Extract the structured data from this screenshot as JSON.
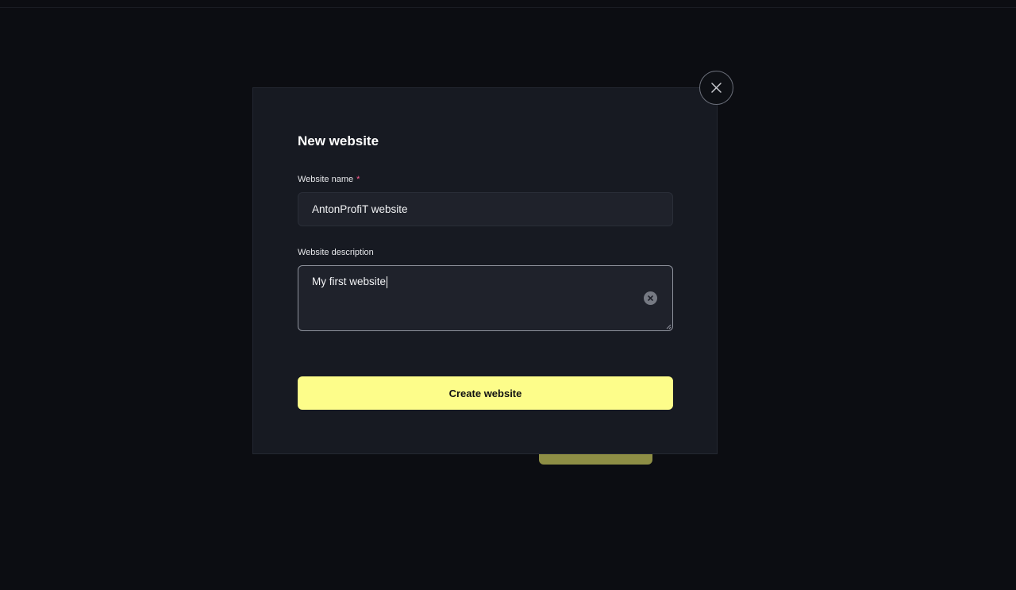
{
  "modal": {
    "title": "New website",
    "name_field": {
      "label": "Website name",
      "required_marker": "*",
      "value": "AntonProfiT website"
    },
    "description_field": {
      "label": "Website description",
      "value": "My first website"
    },
    "submit_label": "Create website"
  },
  "icons": {
    "close": "close-icon",
    "clear": "clear-input-icon",
    "resize": "resize-handle-icon"
  },
  "colors": {
    "background": "#0c0d12",
    "modal_background": "#171a22",
    "input_background": "#1f222b",
    "accent": "#fdfd8a",
    "required": "#ff5d8f"
  }
}
